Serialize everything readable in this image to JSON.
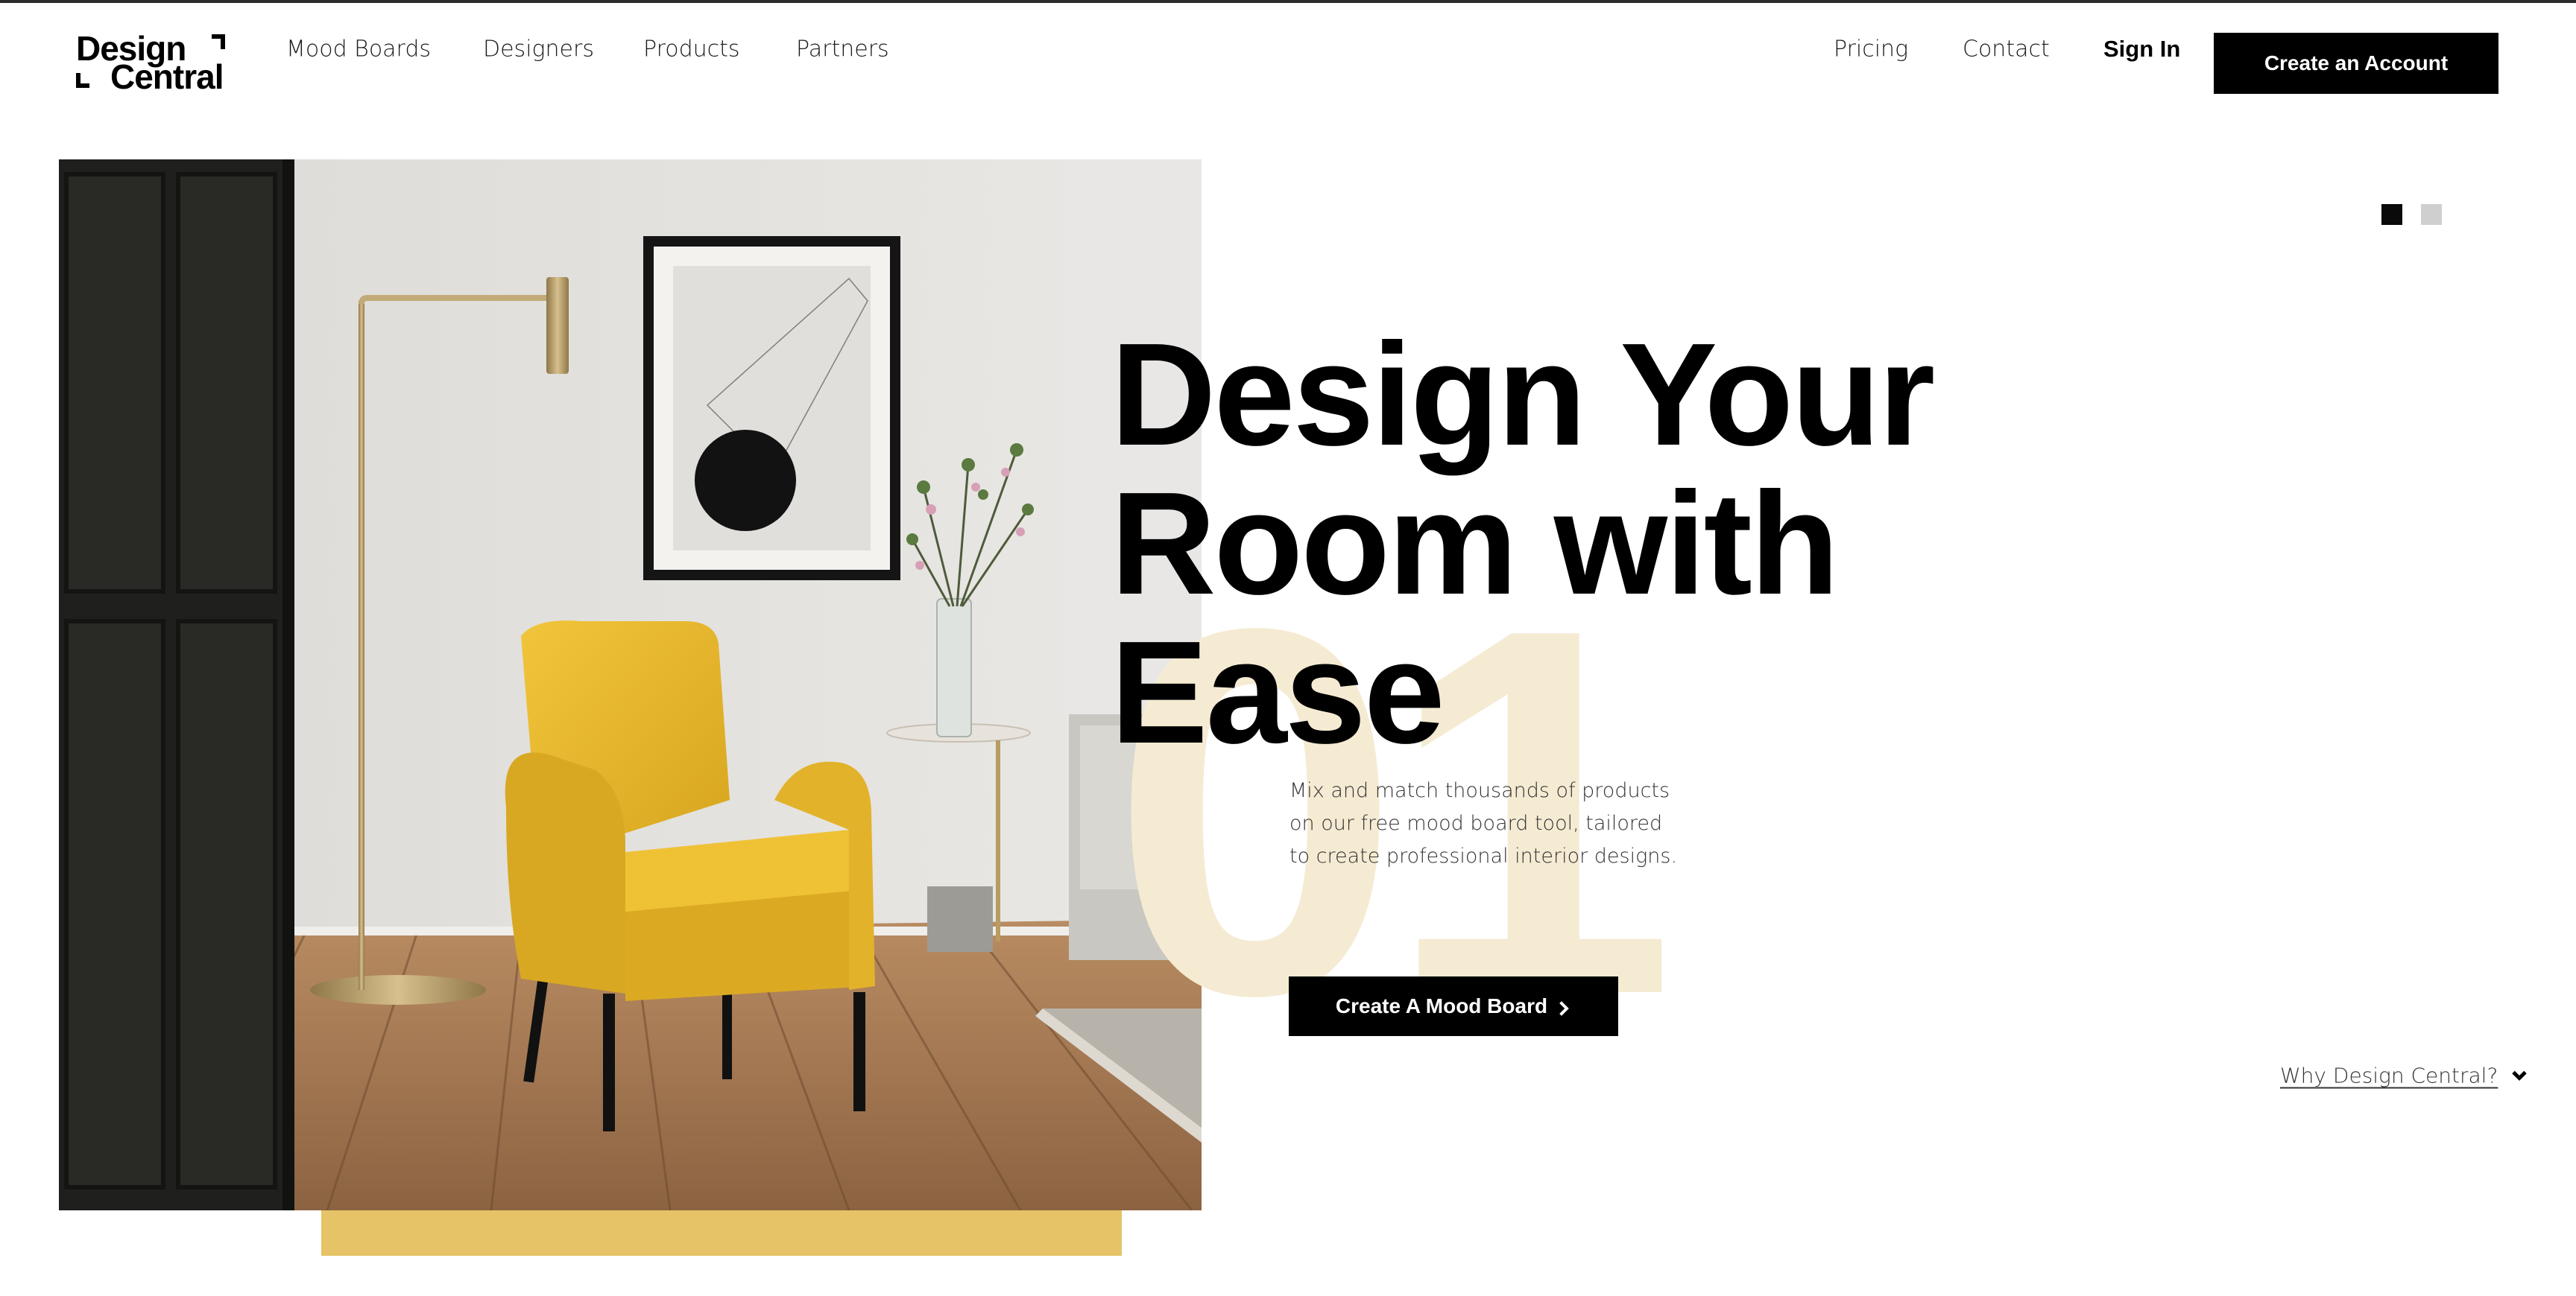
{
  "brand": {
    "logo_line1": "Design",
    "logo_line2": "Central",
    "color": "#000000"
  },
  "nav_left": {
    "mood_boards": "Mood Boards",
    "designers": "Designers",
    "products": "Products",
    "partners": "Partners"
  },
  "nav_right": {
    "pricing": "Pricing",
    "contact": "Contact",
    "sign_in": "Sign In",
    "create_account": "Create an Account"
  },
  "hero": {
    "headline_line1": "Design Your",
    "headline_line2": "Room with",
    "headline_line3": "Ease",
    "slide_number": "01",
    "description_line1": "Mix and match thousands of products",
    "description_line2": "on our free mood board tool, tailored",
    "description_line3": "to create professional interior designs.",
    "cta_label": "Create A Mood Board",
    "cta_icon": "chevron-right-icon",
    "image_alt": "yellow armchair in living room"
  },
  "slider": {
    "total_slides": 2,
    "active_slide": 1
  },
  "why_link": {
    "label": "Why Design Central?",
    "icon": "chevron-down-icon"
  },
  "colors": {
    "accent_yellow": "#e5c366",
    "number_watermark": "#f5ebd3",
    "button_bg": "#000000",
    "button_text": "#ffffff",
    "inactive_dot": "#cfcfcf"
  }
}
